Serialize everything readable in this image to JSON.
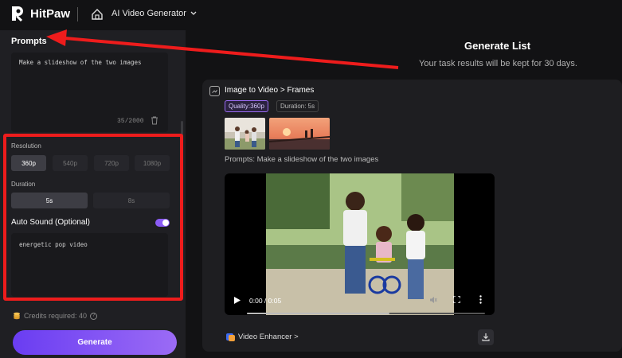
{
  "app": {
    "name": "HitPaw",
    "tool": "AI Video Generator"
  },
  "left_panel": {
    "prompts_title": "Prompts",
    "prompt_text": "Make a slideshow of the two images",
    "prompt_count": "35/2000",
    "resolution_label": "Resolution",
    "resolutions": [
      "360p",
      "540p",
      "720p",
      "1080p"
    ],
    "resolution_selected": "360p",
    "duration_label": "Duration",
    "durations": [
      "5s",
      "8s"
    ],
    "duration_selected": "5s",
    "auto_sound_label": "Auto Sound (Optional)",
    "auto_sound_on": true,
    "sound_text": "energetic pop video",
    "credits": "Credits required: 40",
    "generate_label": "Generate"
  },
  "generate_list": {
    "title": "Generate List",
    "subtitle": "Your task results will be kept for 30 days."
  },
  "task_card": {
    "path": "Image to Video > Frames",
    "quality_tag": "Quality:360p",
    "duration_tag": "Duration: 5s",
    "prompt_line": "Prompts:  Make a slideshow of the two images",
    "video_time": "0:00 / 0:05",
    "enhancer_label": "Video Enhancer >",
    "progress": 0.6
  },
  "colors": {
    "accent": "#8b5cf6",
    "highlight": "#ee1c1c"
  }
}
